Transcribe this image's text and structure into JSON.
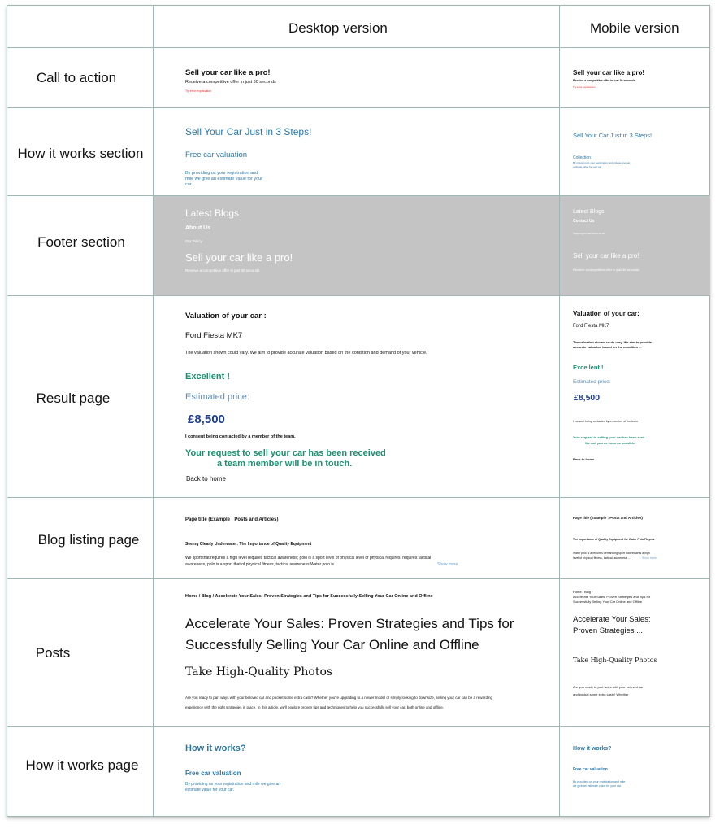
{
  "headers": {
    "desktop": "Desktop version",
    "mobile": "Mobile version"
  },
  "rows": {
    "cta": "Call to action",
    "how_section": "How it works section",
    "footer": "Footer section",
    "result": "Result page",
    "blog_listing": "Blog listing page",
    "posts": "Posts",
    "how_page": "How it works page"
  },
  "cta": {
    "desktop": {
      "title": "Sell your car like a pro!",
      "subtitle": "Receive a competitive offer in just 30 seconds",
      "error": "Try error explanation"
    },
    "mobile": {
      "title": "Sell your car like a pro!",
      "subtitle": "Receive a competitive offer in just 30 seconds",
      "error": "Try error explanation"
    }
  },
  "how_section": {
    "desktop": {
      "title": "Sell Your Car Just in 3 Steps!",
      "step_title": "Free car valuation",
      "step_text_1": "By providing us your registration and",
      "step_text_2": "mile we give an estimate value for your",
      "step_text_3": "car."
    },
    "mobile": {
      "title": "Sell Your Car Just in 3 Steps!",
      "step_title": "Collection",
      "step_text_1": "By providing us your registration and mile we give an",
      "step_text_2": "estimate value for your car"
    }
  },
  "footer": {
    "desktop": {
      "blogs": "Latest Blogs",
      "about": "About Us",
      "policy": "Our Policy",
      "title": "Sell your car like a pro!",
      "subtitle": "Receive a competitive offer in just 30 seconds"
    },
    "mobile": {
      "blogs": "Latest Blogs",
      "contact": "Contact Us",
      "email": "Support@domainname.co.uk",
      "title": "Sell your car like a pro!",
      "subtitle": "Receive a competitive offer in just 30 seconds"
    }
  },
  "result": {
    "desktop": {
      "heading": "Valuation of your car :",
      "model": "Ford Fiesta MK7",
      "disclaimer": "The valuation shown could vary. We aim to provide accurate valuation based on the condition and demand of your vehicle.",
      "rating": "Excellent !",
      "est_label": "Estimated price:",
      "price": "£8,500",
      "consent": "I consent being contacted by a member of the team.",
      "received_1": "Your request to sell your car has been received",
      "received_2": "a team member will be in touch.",
      "back": "Back to home"
    },
    "mobile": {
      "heading": "Valuation of your car:",
      "model": "Ford Fiesta MK7",
      "disclaimer_1": "The valuation shown could vary. We aim to provide",
      "disclaimer_2": "accurate valuation based on the condition ...",
      "rating": "Excellent !",
      "est_label": "Estimated price:",
      "price": "£8,500",
      "consent": "I consent being contacted by a member of the team",
      "received_1": "Your request to selling your car has been sent",
      "received_2": "We call you as soon as possible.",
      "back": "Back to home"
    }
  },
  "blog_listing": {
    "desktop": {
      "page_title": "Page title (Example : Posts and Articles)",
      "post_title": "Seeing Clearly Underwater: The Importance of Quality Equipment",
      "excerpt_1": "We  sport that requires a high level requires tactical awareness; polo is a  sport    level of physical level of physical requires, requires tactical",
      "excerpt_2": "awareness, polo is a  sport that of physical fitness, tactical awareness,Water polo is...",
      "show_more": "Show more"
    },
    "mobile": {
      "page_title": "Page title (Example : Posts and Articles)",
      "post_title": "The Importance of Quality Equipment for Water Polo Players",
      "excerpt_1": "Water polo is a requires demanding sport that requires a high",
      "excerpt_2": "level of physical fitness, tactical awareness ...",
      "show_more": "Show more"
    }
  },
  "posts": {
    "desktop": {
      "breadcrumb": "Home / Blog / Accelerate Your Sales: Proven Strategies and Tips for Successfully Selling Your Car Online and Offline",
      "title_1": "Accelerate Your Sales: Proven Strategies and Tips for",
      "title_2": "Successfully Selling Your Car Online and Offline",
      "subtitle": "Take High-Quality Photos",
      "body_1": "Are you ready to part ways with your beloved car and pocket some extra cash? Whether you're upgrading to a newer model or simply looking to downsize, selling your car can be a rewarding",
      "body_2": "experience with the right strategies in place. In this article, we'll explore proven tips and techniques to help you successfully sell your car, both online and offline."
    },
    "mobile": {
      "breadcrumb_1": "Home / Blog /",
      "breadcrumb_2": "Accelerate Your Sales: Proven Strategies and Tips for",
      "breadcrumb_3": "Successfully Selling Your Car Online and Offline",
      "title_1": "Accelerate Your Sales:",
      "title_2": "Proven Strategies ...",
      "subtitle": "Take High-Quality Photos",
      "body_1": "Are you ready to part ways with your beloved car",
      "body_2": "and pocket some extra cash? Whether"
    }
  },
  "how_page": {
    "desktop": {
      "title": "How it works?",
      "step_title": "Free car valuation",
      "step_text_1": "By  providing  us  your  registration  and  mile  we  give  an",
      "step_text_2": "estimate value for your car."
    },
    "mobile": {
      "title": "How it works?",
      "step_title": "Free car valuation",
      "step_text_1": "By providing us your registration and mile",
      "step_text_2": "we give an estimate value for your car."
    }
  },
  "colors": {
    "accent_blue": "#2a78a7",
    "success_green": "#18916f",
    "price_navy": "#1e3e8f",
    "footer_grey": "#c4c4c4",
    "error_red": "#e32b2b",
    "border": "#9fb8b3"
  }
}
